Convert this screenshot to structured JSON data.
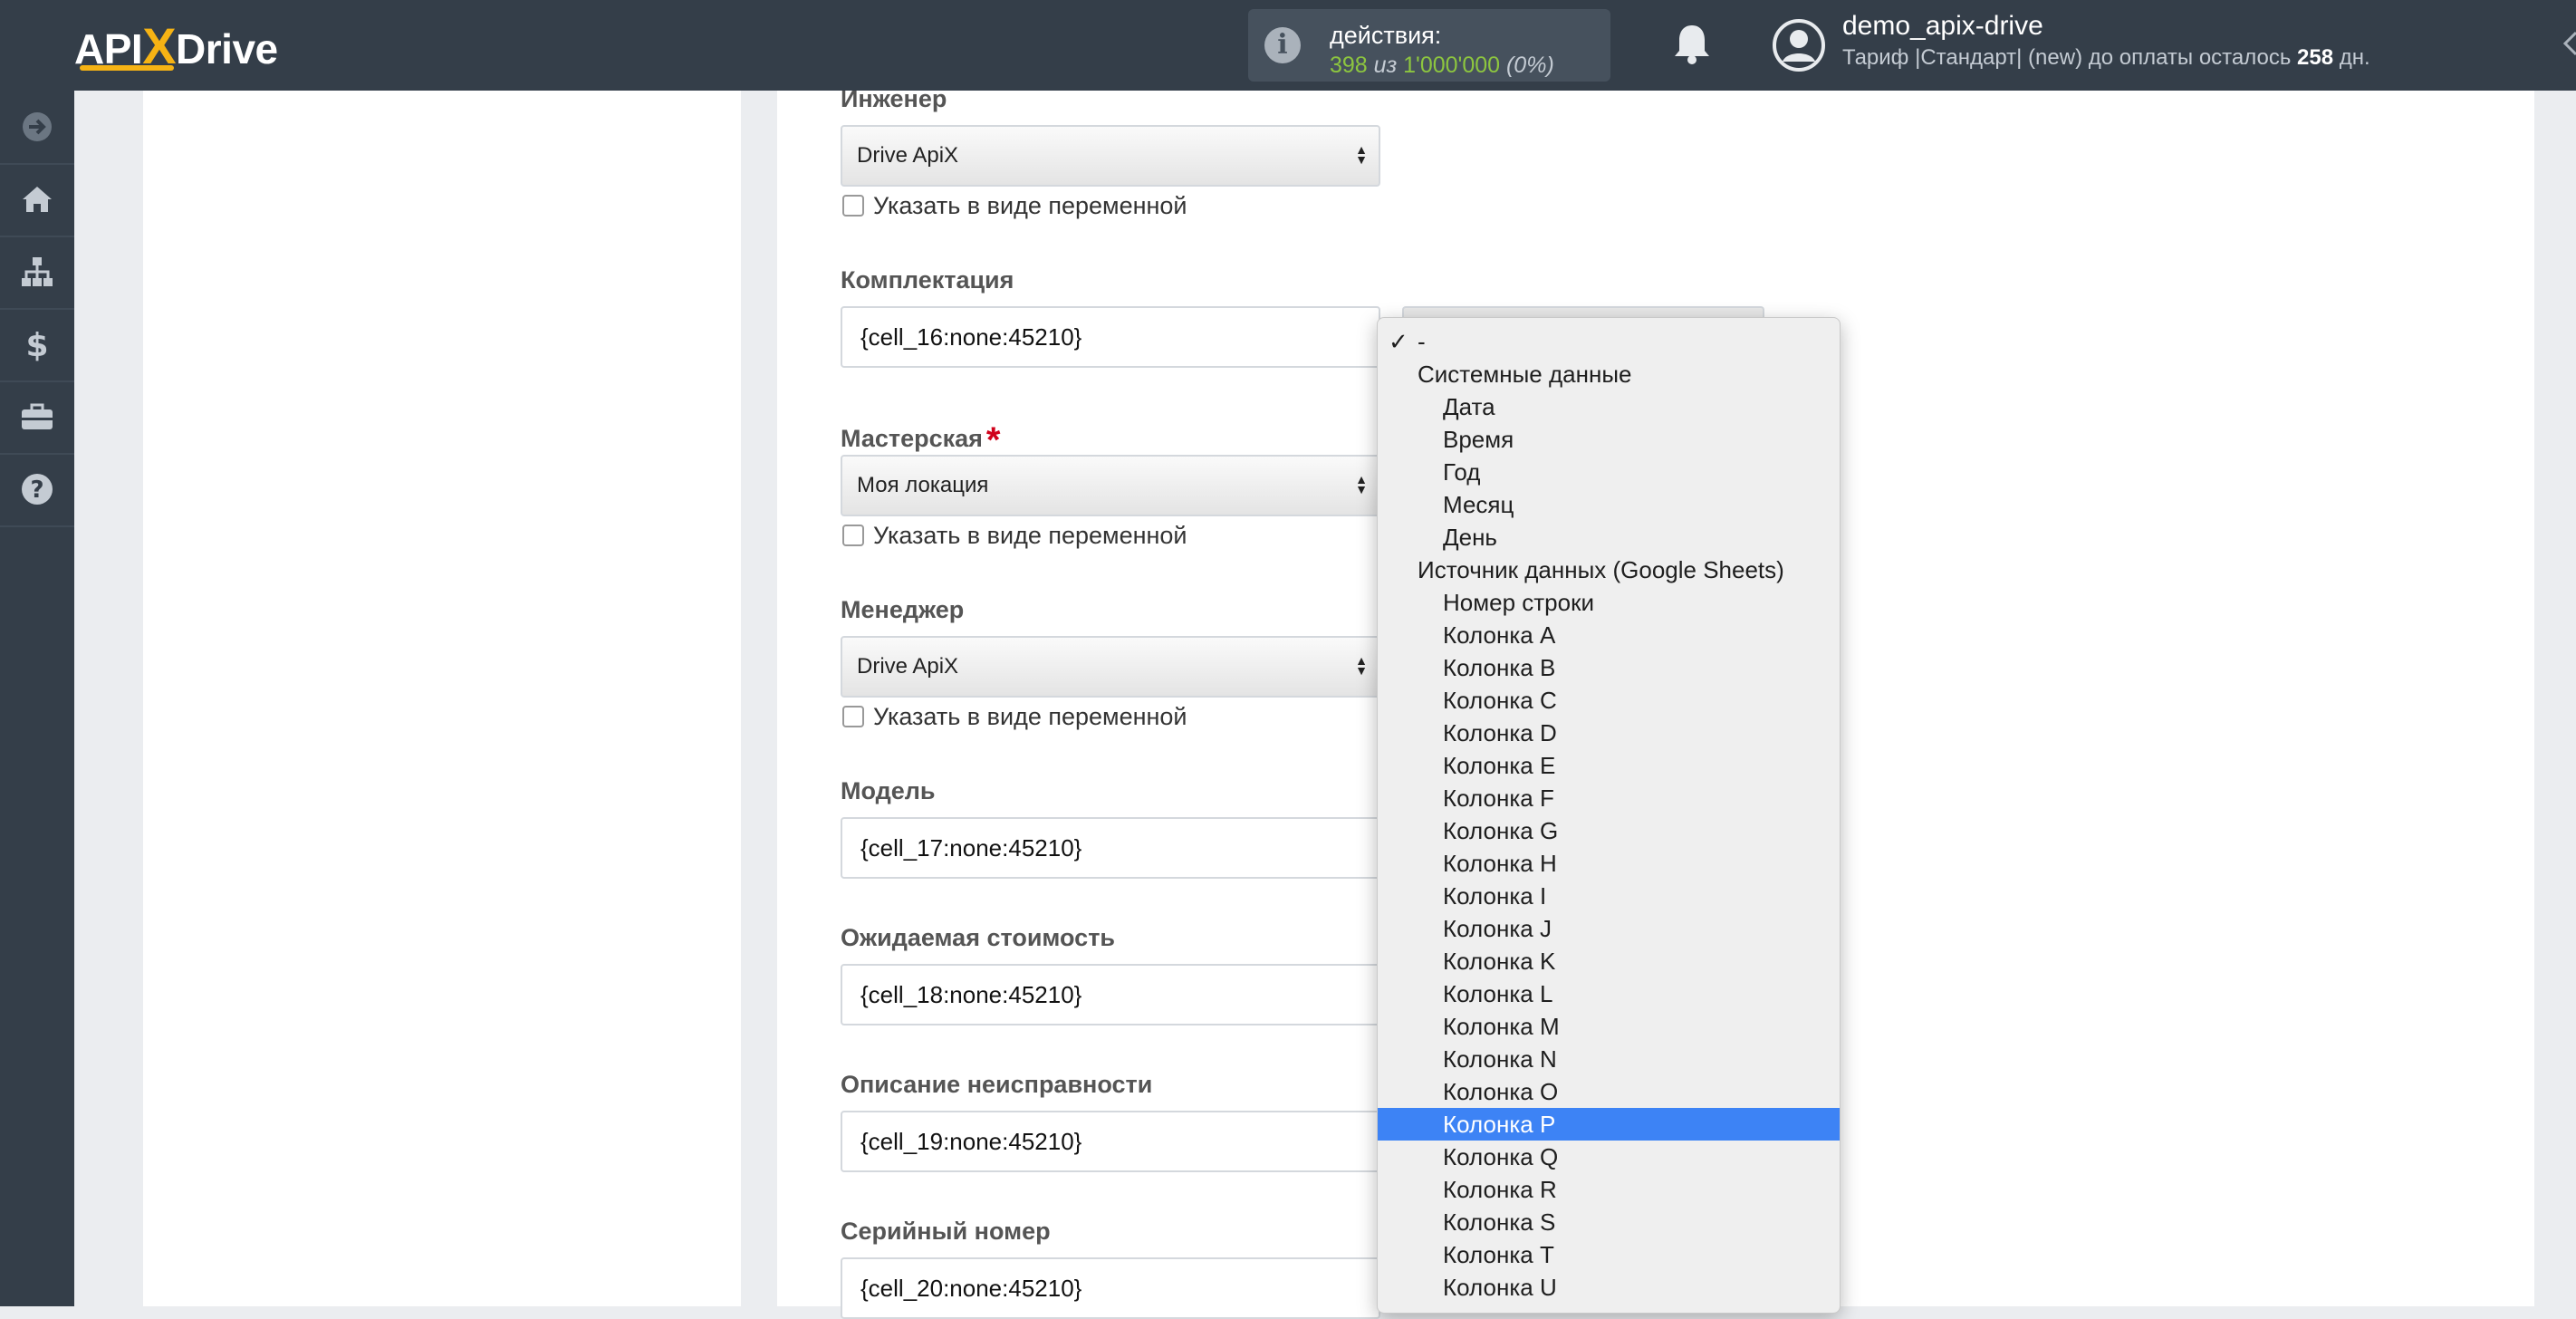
{
  "header": {
    "logo": {
      "left": "API",
      "x": "X",
      "right": "Drive"
    },
    "actions": {
      "label": "действия:",
      "used": "398",
      "of": "из",
      "total": "1'000'000",
      "percent": "(0%)"
    },
    "user": {
      "name": "demo_apix-drive",
      "tariff_prefix": "Тариф |Стандарт| (new) до оплаты осталось",
      "days": "258",
      "days_suffix": "дн."
    }
  },
  "sidebar": {
    "items": [
      {
        "icon": "arrow-circle-right-icon"
      },
      {
        "icon": "home-icon"
      },
      {
        "icon": "sitemap-icon"
      },
      {
        "icon": "dollar-icon"
      },
      {
        "icon": "briefcase-icon"
      },
      {
        "icon": "question-icon"
      }
    ]
  },
  "form": {
    "engineer": {
      "label": "Инженер",
      "value": "Drive ApiX",
      "checkbox": "Указать в виде переменной"
    },
    "equipment": {
      "label": "Комплектация",
      "value": "{cell_16:none:45210}"
    },
    "workshop": {
      "label": "Мастерская",
      "required": "*",
      "value": "Моя локация",
      "checkbox": "Указать в виде переменной"
    },
    "manager": {
      "label": "Менеджер",
      "value": "Drive ApiX",
      "checkbox": "Указать в виде переменной"
    },
    "model": {
      "label": "Модель",
      "value": "{cell_17:none:45210}"
    },
    "expected_cost": {
      "label": "Ожидаемая стоимость",
      "value": "{cell_18:none:45210}"
    },
    "fault_description": {
      "label": "Описание неисправности",
      "value": "{cell_19:none:45210}"
    },
    "serial_number": {
      "label": "Серийный номер",
      "value": "{cell_20:none:45210}"
    }
  },
  "dropdown": {
    "checked_mark": "✓",
    "options": [
      {
        "label": "-",
        "level": 0,
        "checked": true
      },
      {
        "label": "Системные данные",
        "level": 0
      },
      {
        "label": "Дата",
        "level": 1
      },
      {
        "label": "Время",
        "level": 1
      },
      {
        "label": "Год",
        "level": 1
      },
      {
        "label": "Месяц",
        "level": 1
      },
      {
        "label": "День",
        "level": 1
      },
      {
        "label": "Источник данных (Google Sheets)",
        "level": 0
      },
      {
        "label": "Номер строки",
        "level": 1
      },
      {
        "label": "Колонка A",
        "level": 1
      },
      {
        "label": "Колонка B",
        "level": 1
      },
      {
        "label": "Колонка C",
        "level": 1
      },
      {
        "label": "Колонка D",
        "level": 1
      },
      {
        "label": "Колонка E",
        "level": 1
      },
      {
        "label": "Колонка F",
        "level": 1
      },
      {
        "label": "Колонка G",
        "level": 1
      },
      {
        "label": "Колонка H",
        "level": 1
      },
      {
        "label": "Колонка I",
        "level": 1
      },
      {
        "label": "Колонка J",
        "level": 1
      },
      {
        "label": "Колонка K",
        "level": 1
      },
      {
        "label": "Колонка L",
        "level": 1
      },
      {
        "label": "Колонка M",
        "level": 1
      },
      {
        "label": "Колонка N",
        "level": 1
      },
      {
        "label": "Колонка O",
        "level": 1
      },
      {
        "label": "Колонка P",
        "level": 1,
        "highlighted": true
      },
      {
        "label": "Колонка Q",
        "level": 1
      },
      {
        "label": "Колонка R",
        "level": 1
      },
      {
        "label": "Колонка S",
        "level": 1
      },
      {
        "label": "Колонка T",
        "level": 1
      },
      {
        "label": "Колонка U",
        "level": 1
      }
    ]
  },
  "colors": {
    "header_bg": "#343e49",
    "accent": "#f6b314",
    "count_green": "#8dc63f",
    "highlight": "#3d83f5",
    "required": "#d0021b"
  }
}
